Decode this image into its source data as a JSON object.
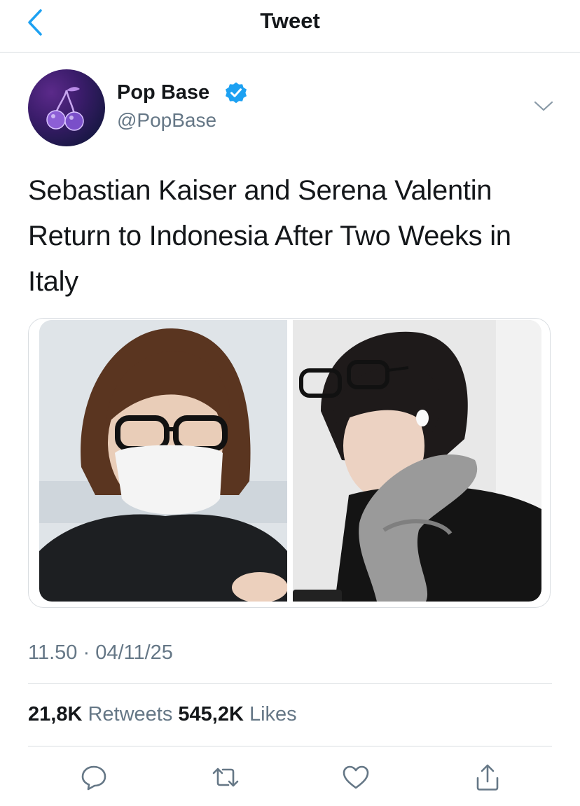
{
  "header": {
    "title": "Tweet",
    "back_icon": "chevron-left-icon",
    "accent_color": "#1da1f2"
  },
  "tweet": {
    "author": {
      "name": "Pop Base",
      "handle": "@PopBase",
      "verified": true,
      "avatar_icon": "cherry-icon"
    },
    "text": "Sebastian Kaiser and Serena Valentin Return to Indonesia After Two Weeks in Italy",
    "media": [
      {
        "alt": "photo-1"
      },
      {
        "alt": "photo-2"
      }
    ],
    "timestamp": "11.50 · 04/11/25",
    "stats": {
      "retweets_count": "21,8K",
      "retweets_label": "Retweets",
      "likes_count": "545,2K",
      "likes_label": "Likes"
    },
    "actions": [
      {
        "name": "reply",
        "icon": "comment-icon"
      },
      {
        "name": "retweet",
        "icon": "retweet-icon"
      },
      {
        "name": "like",
        "icon": "heart-icon"
      },
      {
        "name": "share",
        "icon": "share-icon"
      }
    ]
  },
  "colors": {
    "text_primary": "#14171a",
    "text_secondary": "#657786",
    "divider": "#d9dde1",
    "verified_blue": "#1da1f2"
  }
}
